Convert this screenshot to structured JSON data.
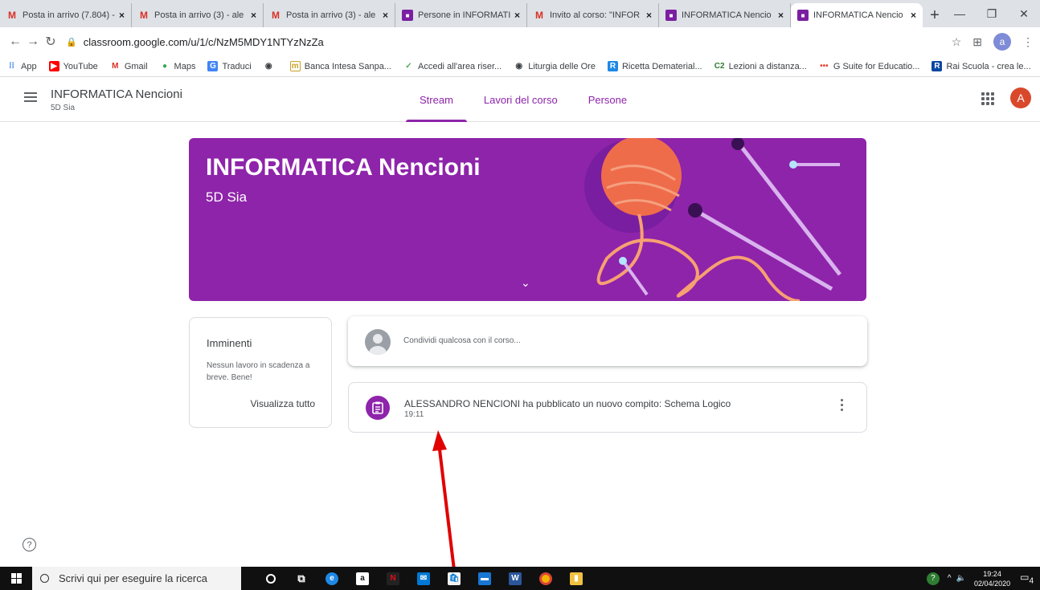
{
  "browser": {
    "tabs": [
      {
        "title": "Posta in arrivo (7.804) -",
        "favicon": "gmail-icon"
      },
      {
        "title": "Posta in arrivo (3) - ale",
        "favicon": "gmail-icon"
      },
      {
        "title": "Posta in arrivo (3) - ale",
        "favicon": "gmail-icon"
      },
      {
        "title": "Persone in INFORMATI",
        "favicon": "classroom-icon"
      },
      {
        "title": "Invito al corso: \"INFOR",
        "favicon": "gmail-icon"
      },
      {
        "title": "INFORMATICA Nencio",
        "favicon": "classroom-icon"
      },
      {
        "title": "INFORMATICA Nencio",
        "favicon": "classroom-icon",
        "active": true
      }
    ],
    "url": "classroom.google.com/u/1/c/NzM5MDY1NTYzNzZa",
    "profile_letter": "a",
    "bookmarks": [
      {
        "label": "App",
        "icon": "apps-grid-icon",
        "color": "#1a73e8"
      },
      {
        "label": "YouTube",
        "icon": "youtube-icon",
        "color": "#ff0000"
      },
      {
        "label": "Gmail",
        "icon": "gmail-icon",
        "color": "#d93025"
      },
      {
        "label": "Maps",
        "icon": "maps-pin-icon",
        "color": "#34a853"
      },
      {
        "label": "Traduci",
        "icon": "translate-icon",
        "color": "#4285f4"
      },
      {
        "label": "",
        "icon": "globe-icon",
        "color": "#3c4043"
      },
      {
        "label": "Banca Intesa Sanpa...",
        "icon": "bank-icon",
        "color": "#c9a227"
      },
      {
        "label": "Accedi all'area riser...",
        "icon": "login-icon",
        "color": "#4caf50"
      },
      {
        "label": "Liturgia delle Ore",
        "icon": "globe-icon",
        "color": "#3c4043"
      },
      {
        "label": "Ricetta Dematerial...",
        "icon": "prescription-icon",
        "color": "#1e88e5"
      },
      {
        "label": "Lezioni a distanza...",
        "icon": "c2-icon",
        "color": "#2e7d32"
      },
      {
        "label": "G Suite for Educatio...",
        "icon": "gsuite-icon",
        "color": "#ea4335"
      },
      {
        "label": "Rai Scuola - crea le...",
        "icon": "rai-icon",
        "color": "#0d47a1"
      }
    ]
  },
  "classroom": {
    "class_name": "INFORMATICA Nencioni",
    "section": "5D Sia",
    "nav_tabs": [
      "Stream",
      "Lavori del corso",
      "Persone"
    ],
    "avatar_letter": "A"
  },
  "banner": {
    "title": "INFORMATICA Nencioni",
    "subtitle": "5D Sia",
    "color": "#8e24aa"
  },
  "upcoming": {
    "title": "Imminenti",
    "text": "Nessun lavoro in scadenza a breve. Bene!",
    "link": "Visualizza tutto"
  },
  "share": {
    "placeholder": "Condividi qualcosa con il corso..."
  },
  "post": {
    "title": "ALESSANDRO NENCIONI ha pubblicato un nuovo compito: Schema Logico",
    "time": "19:11",
    "icon": "assignment-icon"
  },
  "taskbar": {
    "search_placeholder": "Scrivi qui per eseguire la ricerca",
    "time": "19:24",
    "date": "02/04/2020",
    "notification_count": "4"
  },
  "annotation": {
    "color": "#e00000"
  }
}
